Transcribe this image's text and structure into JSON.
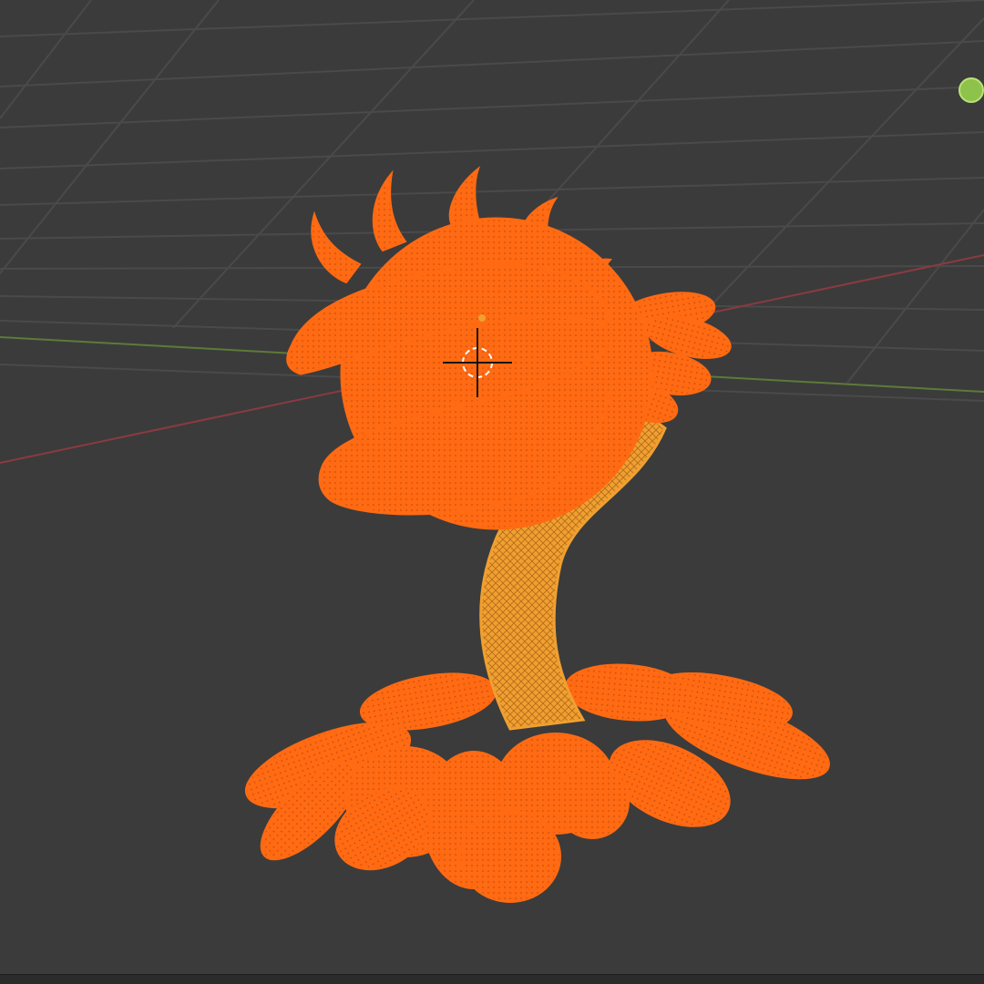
{
  "viewport": {
    "mode": "3D Viewport",
    "shading": "wireframe",
    "colors": {
      "background": "#3b3b3b",
      "grid_line": "#4d4d4d",
      "x_axis": "#8a3a42",
      "y_axis": "#5d7a38",
      "selected_object": "#ff6a12",
      "active_object": "#f0a030"
    }
  },
  "scene": {
    "object": "carnivorous-plant-model",
    "parts": [
      "head",
      "spikes",
      "petals",
      "stem",
      "base-petals"
    ]
  },
  "gizmo": {
    "icon": "green-axis-circle-icon"
  }
}
